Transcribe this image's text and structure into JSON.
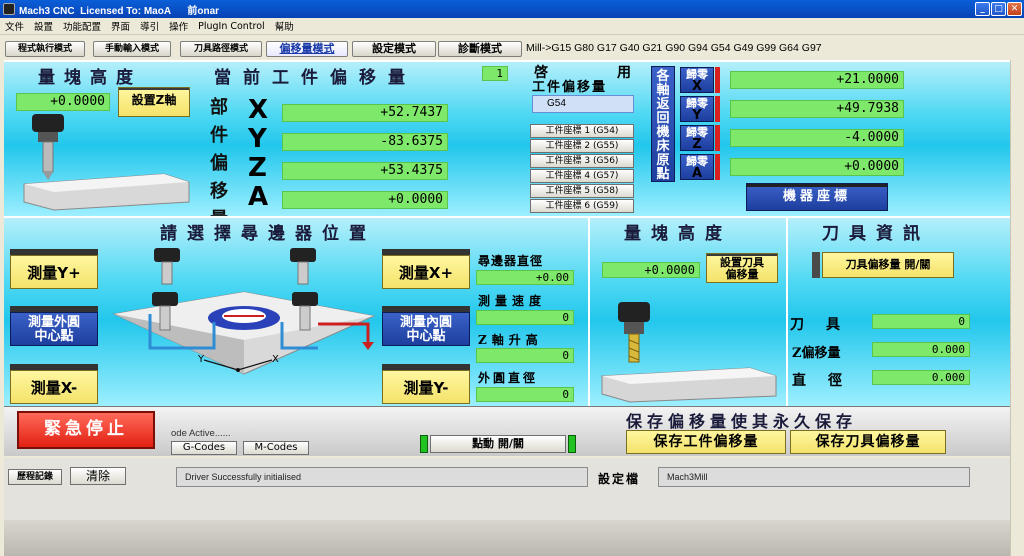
{
  "window": {
    "title": "Mach3 CNC  Licensed To: MaoA      前onar",
    "controls": [
      "_",
      "□",
      "✕"
    ]
  },
  "menu": [
    "文件",
    "設置",
    "功能配置",
    "界面",
    "導引",
    "操作",
    "PlugIn Control",
    "幫助"
  ],
  "tabs": [
    "程式執行模式",
    "手動輸入模式",
    "刀具路徑模式",
    "偏移量模式",
    "設定模式",
    "診斷模式"
  ],
  "gcode_modes": "Mill->G15  G80 G17 G40 G21 G90 G94 G54 G49 G99 G64 G97",
  "gauge_block": {
    "title": "量塊高度",
    "value": "+0.0000",
    "set_z_button": "設置Z軸"
  },
  "work_offset": {
    "title": "當前工件偏移量",
    "offset_number": "1",
    "vertical_label": [
      "部",
      "件",
      "偏",
      "移",
      "量"
    ],
    "axes": [
      {
        "letter": "X",
        "value": "+52.7437"
      },
      {
        "letter": "Y",
        "value": "-83.6375"
      },
      {
        "letter": "Z",
        "value": "+53.4375"
      },
      {
        "letter": "A",
        "value": "+0.0000"
      }
    ]
  },
  "enabled_offset": {
    "label_top": "啓",
    "label_top2": "用",
    "label": "工件偏移量",
    "current": "G54",
    "fixtures": [
      "工件座標 1 (G54)",
      "工件座標 2 (G55)",
      "工件座標 3 (G56)",
      "工件座標 4 (G57)",
      "工件座標 5 (G58)",
      "工件座標 6 (G59)"
    ]
  },
  "homing": {
    "vertical_label": [
      "各",
      "軸",
      "返",
      "回",
      "機",
      "床",
      "原",
      "點"
    ],
    "ref_buttons": [
      {
        "label": "歸零",
        "axis": "X",
        "value": "+21.0000"
      },
      {
        "label": "歸零",
        "axis": "Y",
        "value": "+49.7938"
      },
      {
        "label": "歸零",
        "axis": "Z",
        "value": "-4.0000"
      },
      {
        "label": "歸零",
        "axis": "A",
        "value": "+0.0000"
      }
    ],
    "machine_coords_button": "機器座標"
  },
  "edge_finder": {
    "title": "請選擇尋邊器位置",
    "buttons": {
      "y_plus": "測量Y+",
      "x_plus": "測量X+",
      "x_minus": "測量X-",
      "y_minus": "測量Y-",
      "outer_center": [
        "測量外圓",
        "中心點"
      ],
      "inner_center": [
        "測量內圓",
        "中心點"
      ]
    },
    "diagram_axes": {
      "y": "Y",
      "x": "X"
    },
    "fields": [
      {
        "label": "尋邊器直徑",
        "value": "+0.00"
      },
      {
        "label": "測量速度",
        "value": "0"
      },
      {
        "label": "Z軸升高",
        "value": "0"
      },
      {
        "label": "外圓直徑",
        "value": "0"
      }
    ]
  },
  "gauge_block_2": {
    "title": "量塊高度",
    "value": "+0.0000",
    "set_button": [
      "設置刀具",
      "偏移量"
    ]
  },
  "tool_info": {
    "title": "刀具資訊",
    "toggle_button": "刀具偏移量 開/關",
    "fields": [
      {
        "label": "刀具",
        "value": "0"
      },
      {
        "label": "Z偏移量",
        "value": "0.000"
      },
      {
        "label": "直徑",
        "value": "0.000"
      }
    ]
  },
  "save_section": {
    "title": "保存偏移量使其永久保存",
    "save_work_offsets": "保存工件偏移量",
    "save_tool_offsets": "保存刀具偏移量"
  },
  "bottom": {
    "estop": "緊急停止",
    "mode_active": "ode Active......",
    "gcodes_button": "G-Codes",
    "mcodes_button": "M-Codes",
    "jog_button": "點動 開/關",
    "history_button": "歷程記錄",
    "clear_button": "清除",
    "status_message": "Driver Successfully initialised",
    "profile_label": "設定檔",
    "profile_value": "Mach3Mill"
  },
  "colors": {
    "lcd_green": "#7ee86a",
    "button_yellow": "#f4e26a",
    "cyan_panel": "#22c7ec",
    "estop_red": "#e22012",
    "title_bar": "#0842b5"
  }
}
